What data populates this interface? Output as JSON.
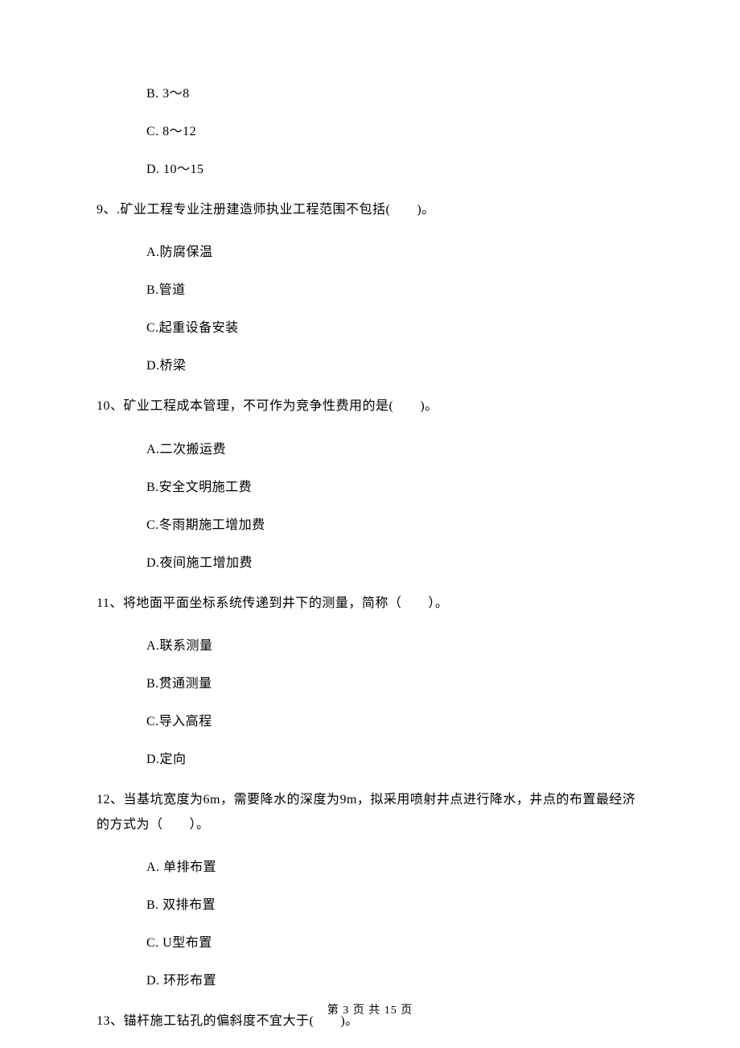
{
  "options_top": {
    "b": "B. 3～8",
    "c": "C. 8～12",
    "d": "D. 10～15"
  },
  "q9": {
    "stem": "9、.矿业工程专业注册建造师执业工程范围不包括(　　)。",
    "a": "A.防腐保温",
    "b": "B.管道",
    "c": "C.起重设备安装",
    "d": "D.桥梁"
  },
  "q10": {
    "stem": "10、矿业工程成本管理，不可作为竞争性费用的是(　　)。",
    "a": "A.二次搬运费",
    "b": "B.安全文明施工费",
    "c": "C.冬雨期施工增加费",
    "d": "D.夜间施工增加费"
  },
  "q11": {
    "stem": "11、将地面平面坐标系统传递到井下的测量，简称（　　）。",
    "a": "A.联系测量",
    "b": "B.贯通测量",
    "c": "C.导入高程",
    "d": "D.定向"
  },
  "q12": {
    "stem": "12、当基坑宽度为6m，需要降水的深度为9m，拟采用喷射井点进行降水，井点的布置最经济的方式为（　　）。",
    "a": "A. 单排布置",
    "b": "B. 双排布置",
    "c": "C. U型布置",
    "d": "D. 环形布置"
  },
  "q13": {
    "stem": "13、锚杆施工钻孔的偏斜度不宜大于(　　)。"
  },
  "footer": "第 3 页 共 15 页"
}
